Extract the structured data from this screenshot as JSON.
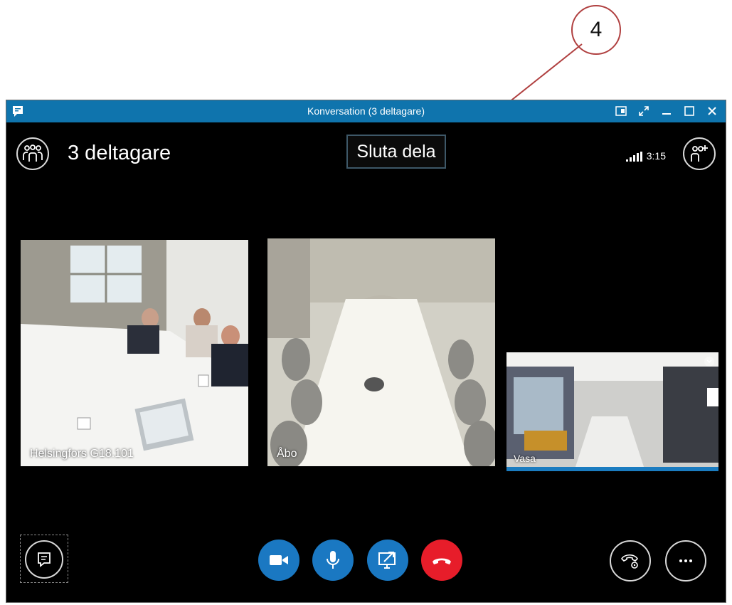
{
  "callout": {
    "number": "4"
  },
  "window": {
    "title": "Konversation (3 deltagare)"
  },
  "header": {
    "participants_label": "3 deltagare",
    "stop_sharing_label": "Sluta dela",
    "call_duration": "3:15"
  },
  "tiles": [
    {
      "label": "Helsingfors G18.101"
    },
    {
      "label": "Åbo"
    },
    {
      "label": "Vasa",
      "active_speaker": true
    }
  ],
  "colors": {
    "titlebar": "#0f74ad",
    "action_blue": "#1a78c2",
    "hangup_red": "#e71d2a",
    "callout_stroke": "#b04040"
  },
  "icons": {
    "participants": "participants-icon",
    "add_participant": "add-participant-icon",
    "chat": "chat-icon",
    "video": "video-camera-icon",
    "microphone": "microphone-icon",
    "share": "share-screen-icon",
    "hangup": "hang-up-icon",
    "call_controls": "call-controls-icon",
    "more": "more-options-icon"
  }
}
